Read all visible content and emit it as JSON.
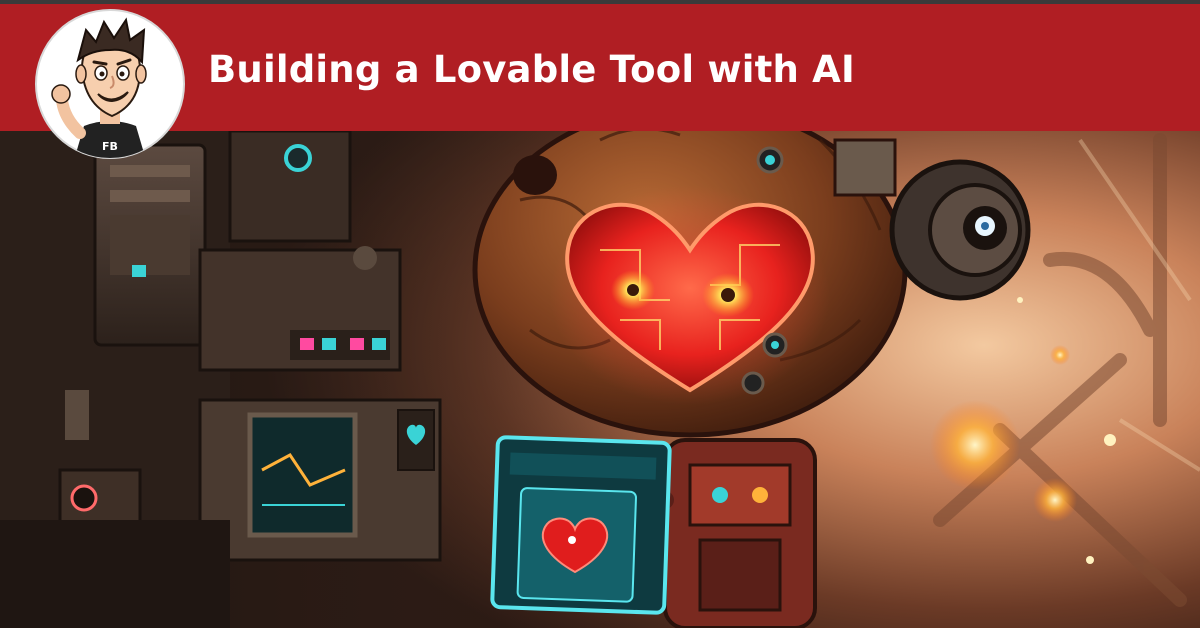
{
  "banner": {
    "title": "Building a Lovable Tool with AI",
    "background_color": "#B01E23",
    "text_color": "#FFFFFF"
  },
  "avatar": {
    "icon": "cartoon-man-avatar-icon",
    "shirt_text": "FB"
  },
  "illustration": {
    "icon": "robot-heart-illustration",
    "monitor_icon": "heart-monitor-icon"
  }
}
